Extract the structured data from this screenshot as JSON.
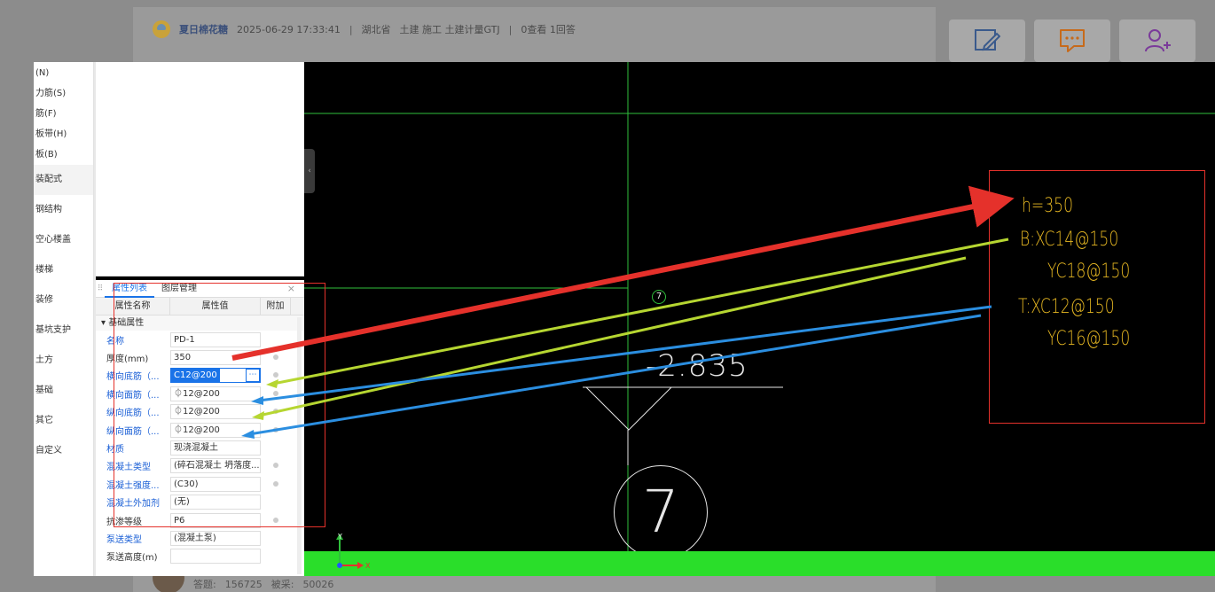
{
  "post": {
    "author": "夏日棉花糖",
    "datetime": "2025-06-29 17:33:41",
    "region": "湖北省",
    "tags": "土建 施工 土建计量GTJ",
    "stats": "0查看 1回答"
  },
  "footer": {
    "answers_label": "答题:",
    "answers": "156725",
    "adopted_label": "被采:",
    "adopted": "50026"
  },
  "nav": {
    "small_items": [
      "(N)",
      "力筋(S)",
      "筋(F)",
      "板带(H)",
      "板(B)"
    ],
    "items": [
      "装配式",
      "钢结构",
      "空心楼盖",
      "楼梯",
      "装修",
      "基坑支护",
      "土方",
      "基础",
      "其它",
      "自定义"
    ]
  },
  "panel": {
    "tabs": [
      "属性列表",
      "图层管理"
    ],
    "close": "×",
    "grip": "⠿",
    "columns": [
      "属性名称",
      "属性值",
      "附加"
    ],
    "group": "基础属性",
    "rows": [
      {
        "name": "名称",
        "value": "PD-1"
      },
      {
        "name": "厚度(mm)",
        "value": "350"
      },
      {
        "name": "横向底筋（...",
        "value": "C12@200"
      },
      {
        "name": "横向面筋（...",
        "value": "⏀12@200"
      },
      {
        "name": "纵向底筋（...",
        "value": "⏀12@200"
      },
      {
        "name": "纵向面筋（...",
        "value": "⏀12@200"
      },
      {
        "name": "材质",
        "value": "现浇混凝土"
      },
      {
        "name": "混凝土类型",
        "value": "(碎石混凝土 坍落度..."
      },
      {
        "name": "混凝土强度...",
        "value": "(C30)"
      },
      {
        "name": "混凝土外加剂",
        "value": "(无)"
      },
      {
        "name": "抗渗等级",
        "value": "P6"
      },
      {
        "name": "泵送类型",
        "value": "(混凝土泵)"
      },
      {
        "name": "泵送高度(m)",
        "value": ""
      }
    ]
  },
  "cad": {
    "elevation": "-2.835",
    "axis_small": "7",
    "axis_big": "7",
    "axis_x_label": "X",
    "axis_y_label": "Y"
  },
  "annotation": {
    "h": "h=350",
    "b1": "B:XC14@150",
    "b2": "YC18@150",
    "t1": "T:XC12@150",
    "t2": "YC16@150"
  },
  "colors": {
    "red_arrow": "#e5312b",
    "green_arrow": "#b6d631",
    "blue_arrow": "#2b8ee0",
    "ground": "#2ade2a",
    "annotation_text": "#e6b722"
  }
}
